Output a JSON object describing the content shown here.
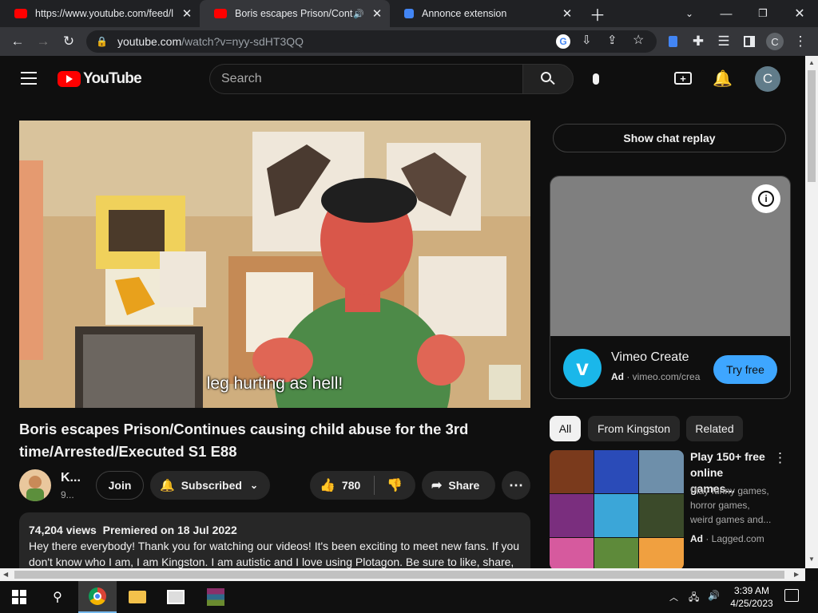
{
  "browser": {
    "tabs": [
      {
        "title": "https://www.youtube.com/feed/l",
        "favicon_color": "#ff0000"
      },
      {
        "title": "Boris escapes Prison/Continu",
        "favicon_color": "#ff0000"
      },
      {
        "title": "Annonce extension",
        "favicon_color": "#4285f4"
      }
    ],
    "address_host": "youtube.com",
    "address_path": "/watch?v=nyy-sdHT3QQ",
    "profile_initial": "C"
  },
  "youtube": {
    "logo_text": "YouTube",
    "search_placeholder": "Search",
    "avatar_initial": "C",
    "video": {
      "subtitle": "leg hurting as hell!",
      "title": "Boris escapes Prison/Continues causing child abuse for the 3rd time/Arrested/Executed S1 E88"
    },
    "channel": {
      "name": "K...",
      "subs": "9..."
    },
    "buttons": {
      "join": "Join",
      "subscribed": "Subscribed",
      "likes": "780",
      "share": "Share"
    },
    "description": {
      "views": "74,204 views",
      "premiered": "Premiered on 18 Jul 2022",
      "text": "Hey there everybody! Thank you for watching our videos! It's been exciting to meet new fans. If you don't know who I am, I am Kingston. I am autistic and I love using Plotagon. Be sure to like, share,"
    }
  },
  "sidebar": {
    "chat_replay": "Show chat replay",
    "ad": {
      "name": "Vimeo Create",
      "badge": "Ad",
      "domain": "vimeo.com/crea",
      "cta": "Try free",
      "logo_letter": "v"
    },
    "chips": [
      "All",
      "From Kingston",
      "Related"
    ],
    "rec": {
      "title": "Play 150+ free online games...",
      "desc": "Play funny games, horror games, weird games and...",
      "badge": "Ad",
      "domain": "Lagged.com"
    }
  },
  "taskbar": {
    "time": "3:39 AM",
    "date": "4/25/2023"
  }
}
